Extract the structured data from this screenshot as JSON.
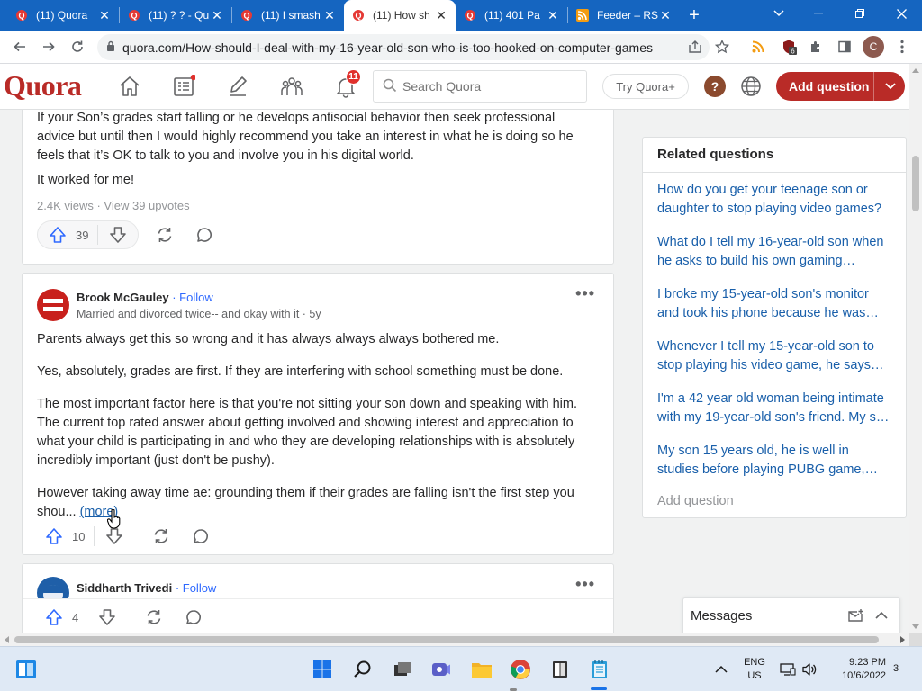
{
  "browser": {
    "tabs": [
      {
        "title": "(11) Quora",
        "icon": "quora-icon",
        "active": false
      },
      {
        "title": "(11) ? ? - Qu",
        "icon": "quora-icon",
        "active": false
      },
      {
        "title": "(11) I smash",
        "icon": "quora-icon",
        "active": false
      },
      {
        "title": "(11) How sh",
        "icon": "quora-icon",
        "active": true
      },
      {
        "title": "(11) 401 Pa",
        "icon": "quora-icon",
        "active": false
      },
      {
        "title": "Feeder – RS",
        "icon": "rss-icon",
        "active": false
      }
    ],
    "url": "quora.com/How-should-I-deal-with-my-16-year-old-son-who-is-too-hooked-on-computer-games",
    "ext_badge": "6",
    "profile_initial": "C",
    "colors": {
      "tabstrip": "#1565c0"
    }
  },
  "quora": {
    "logo": "Quora",
    "notif_count": "11",
    "search_placeholder": "Search Quora",
    "try_plus": "Try Quora+",
    "help": "?",
    "add_question": "Add question",
    "brand_color": "#b92b27"
  },
  "answer1": {
    "text": "If your Son’s grades start falling or he develops antisocial behavior then seek professional advice but until then I would highly recommend you take an interest in what he is doing so he feels that it’s OK to talk to you and involve you in his digital world.",
    "closing": "It worked for me!",
    "stats": "2.4K views · View 39 upvotes",
    "upvotes": "39"
  },
  "answer2": {
    "author": "Brook McGauley",
    "follow": "· Follow",
    "credential": "Married and divorced twice-- and okay with it · 5y",
    "p1": "Parents always get this so wrong and it has always always always bothered me.",
    "p2": "Yes, absolutely, grades are first. If they are interfering with school something must be done.",
    "p3": "The most important factor here is that you're not sitting your son down and speaking with him. The current top rated answer about getting involved and showing interest and appreciation to what your child is participating in and who they are developing relationships with is absolutely incredibly important (just don't be pushy).",
    "p4": "However taking away time ae: grounding them if their grades are falling isn't the first step you shou...",
    "more": "(more)",
    "upvotes": "10"
  },
  "answer3": {
    "author": "Siddharth Trivedi",
    "follow": "· Follow",
    "upvotes": "4"
  },
  "related": {
    "title": "Related questions",
    "items": [
      "How do you get your teenage son or daughter to stop playing video games?",
      "What do I tell my 16-year-old son when he asks to build his own gaming system?",
      "I broke my 15-year-old son's monitor and took his phone because he was playing video games all night. Was I wrong?",
      "Whenever I tell my 15-year-old son to stop playing his video game, he says that he will, but he doesn't. What do I do?",
      "I'm a 42 year old woman being intimate with my 19-year-old son's friend. My son is upset. What should I do?",
      "My son 15 years old, he is well in studies before playing PUBG game, How do I stop him?"
    ],
    "add": "Add question"
  },
  "messages": {
    "label": "Messages"
  },
  "taskbar": {
    "lang1": "ENG",
    "lang2": "US",
    "time": "9:23 PM",
    "date": "10/6/2022",
    "notif": "3"
  }
}
